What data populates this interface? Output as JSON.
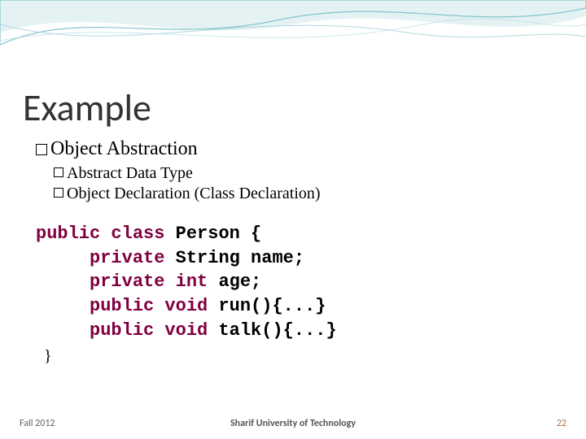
{
  "title": "Example",
  "bullets": {
    "l1": "Object Abstraction",
    "l2a": "Abstract Data Type",
    "l2b": "Object Declaration (Class Declaration)"
  },
  "code": {
    "line1_kw": "public class",
    "line1_rest": " Person {",
    "line2_kw": "private",
    "line2_rest": " String name;",
    "line3_kw": "private int",
    "line3_rest": " age;",
    "line4_kw": "public void",
    "line4_rest": " run(){...}",
    "line5_kw": "public void",
    "line5_rest": " talk(){...}",
    "close": "}"
  },
  "footer": {
    "left": "Fall 2012",
    "center": "Sharif University of Technology",
    "right": "22"
  }
}
